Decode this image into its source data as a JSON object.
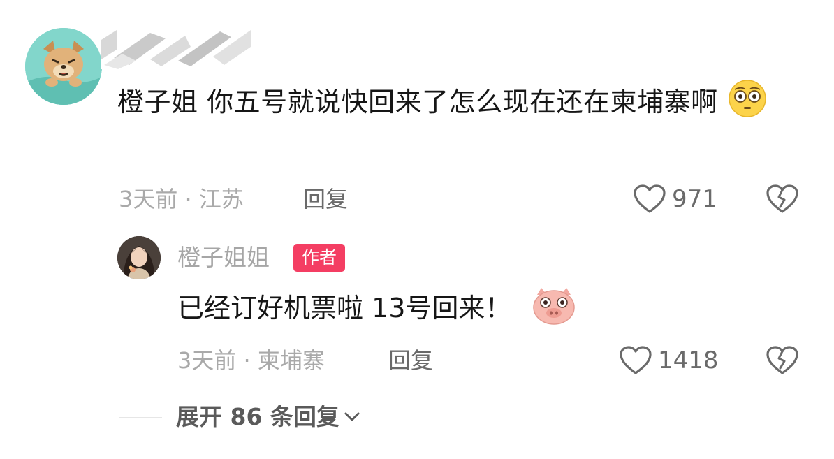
{
  "comment": {
    "text": "橙子姐 你五号就说快回来了怎么现在还在柬埔寨啊",
    "time": "3天前",
    "location": "江苏",
    "reply_label": "回复",
    "likes": "971"
  },
  "reply": {
    "username": "橙子姐姐",
    "badge": "作者",
    "text": "已经订好机票啦 13号回来！",
    "time": "3天前",
    "location": "柬埔寨",
    "reply_label": "回复",
    "likes": "1418"
  },
  "expand": {
    "label": "展开 86 条回复"
  },
  "colors": {
    "badge": "#f43e63",
    "meta_text": "#a9a9a9",
    "body_text": "#161616"
  },
  "icons": [
    "dog-avatar-icon",
    "flushed-face-emoji-icon",
    "heart-outline-icon",
    "broken-heart-icon",
    "pig-face-emoji-icon",
    "chevron-down-icon"
  ]
}
